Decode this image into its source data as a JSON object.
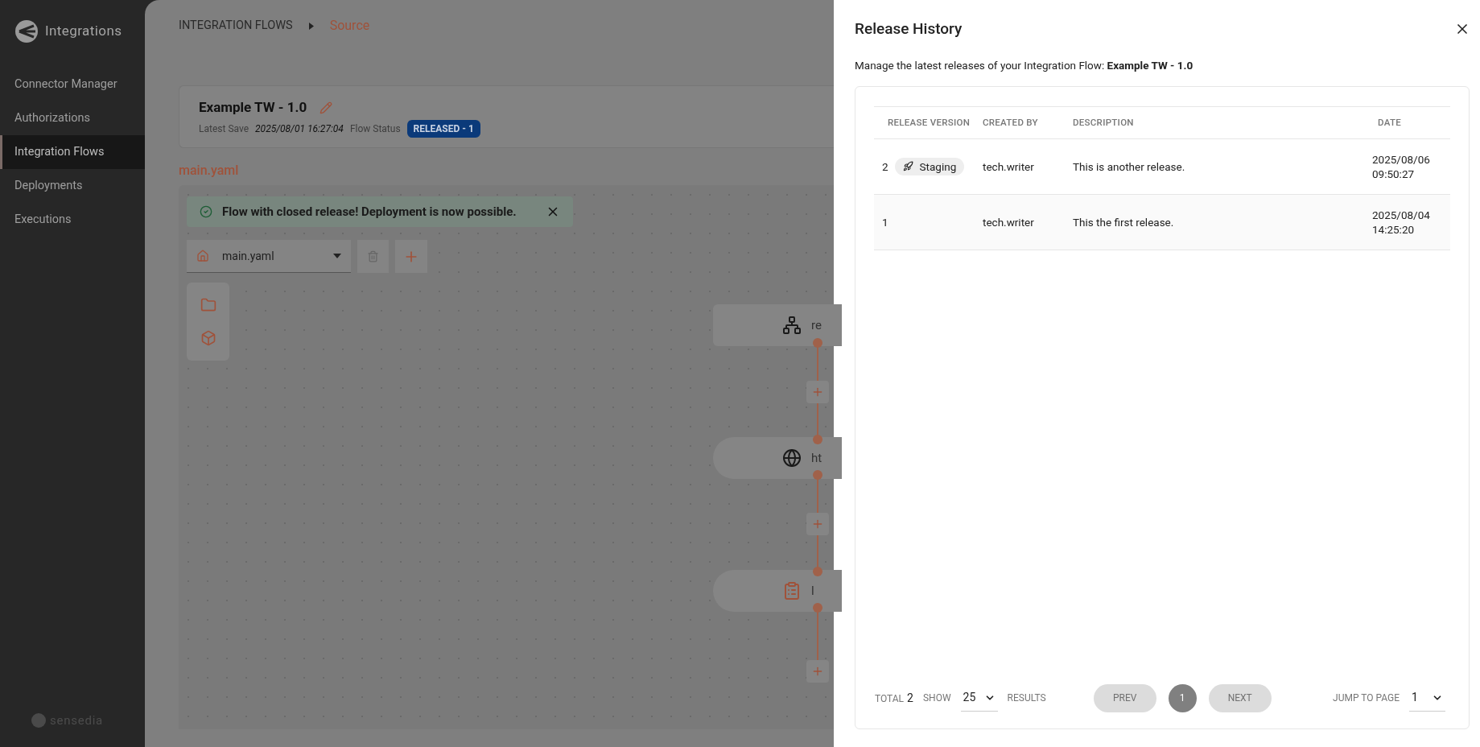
{
  "sidebar": {
    "brand": "Integrations",
    "items": [
      {
        "label": "Connector Manager",
        "selected": false
      },
      {
        "label": "Authorizations",
        "selected": false
      },
      {
        "label": "Integration Flows",
        "selected": true
      },
      {
        "label": "Deployments",
        "selected": false
      },
      {
        "label": "Executions",
        "selected": false
      }
    ],
    "footer_logo": "sensedia"
  },
  "breadcrumb": [
    "INTEGRATION FLOWS",
    "Source"
  ],
  "flow": {
    "name": "Example TW - 1.0",
    "latest_save_label": "Latest Save",
    "latest_save": "2025/08/01 16:27:04",
    "status_label": "Flow Status",
    "status": "RELEASED - 1"
  },
  "file_label": "main.yaml",
  "toast": {
    "message": "Flow with closed release! Deployment is now possible."
  },
  "file_select": {
    "value": "main.yaml"
  },
  "nodes": [
    {
      "kind": "trigger",
      "label": "re"
    },
    {
      "kind": "http",
      "label": "ht"
    },
    {
      "kind": "log",
      "label": "l"
    }
  ],
  "drawer": {
    "title": "Release History",
    "subtitle": "Manage the latest releases of your Integration Flow: **Example TW - 1.0**",
    "columns": [
      "RELEASE VERSION",
      "CREATED BY",
      "DESCRIPTION",
      "DATE"
    ],
    "rows": [
      {
        "version": "2",
        "badge": "Staging",
        "created_by": "tech.writer",
        "description": "This is another release.",
        "date": "2025/08/06 09:50:27"
      },
      {
        "version": "1",
        "created_by": "tech.writer",
        "description": "This the first release.",
        "date": "2025/08/04 14:25:20"
      }
    ],
    "pagination": {
      "total_label": "TOTAL",
      "total": "2",
      "show_label": "SHOW",
      "page_size": "25",
      "results_label": "RESULTS",
      "prev": {
        "label": "PREV",
        "disabled": true
      },
      "pages": [
        {
          "label": "1",
          "selected": true
        }
      ],
      "next": {
        "label": "NEXT",
        "disabled": true
      },
      "jump_label": "JUMP TO PAGE",
      "jump_value": "1"
    }
  }
}
